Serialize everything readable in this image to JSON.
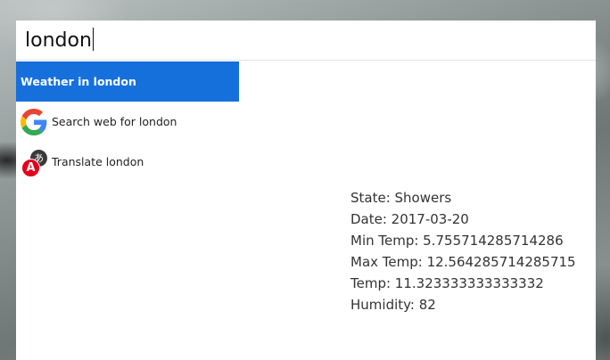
{
  "search": {
    "query": "london"
  },
  "results": [
    {
      "label": "Weather in london",
      "icon": "none",
      "active": true
    },
    {
      "label": "Search web for london",
      "icon": "google-icon",
      "active": false
    },
    {
      "label": "Translate london",
      "icon": "translate-icon",
      "active": false
    }
  ],
  "translate_icon": {
    "dark_glyph": "あ",
    "red_glyph": "A"
  },
  "weather": {
    "state": "State: Showers",
    "date": "Date: 2017-03-20",
    "min_temp": "Min Temp: 5.755714285714286",
    "max_temp": "Max Temp: 12.564285714285715",
    "temp": "Temp: 11.323333333333332",
    "humidity": "Humidity: 82"
  },
  "colors": {
    "accent": "#1570dc",
    "google_blue": "#4285F4",
    "google_red": "#EA4335",
    "google_yellow": "#FBBC05",
    "google_green": "#34A853",
    "translate_red": "#e3001b"
  }
}
